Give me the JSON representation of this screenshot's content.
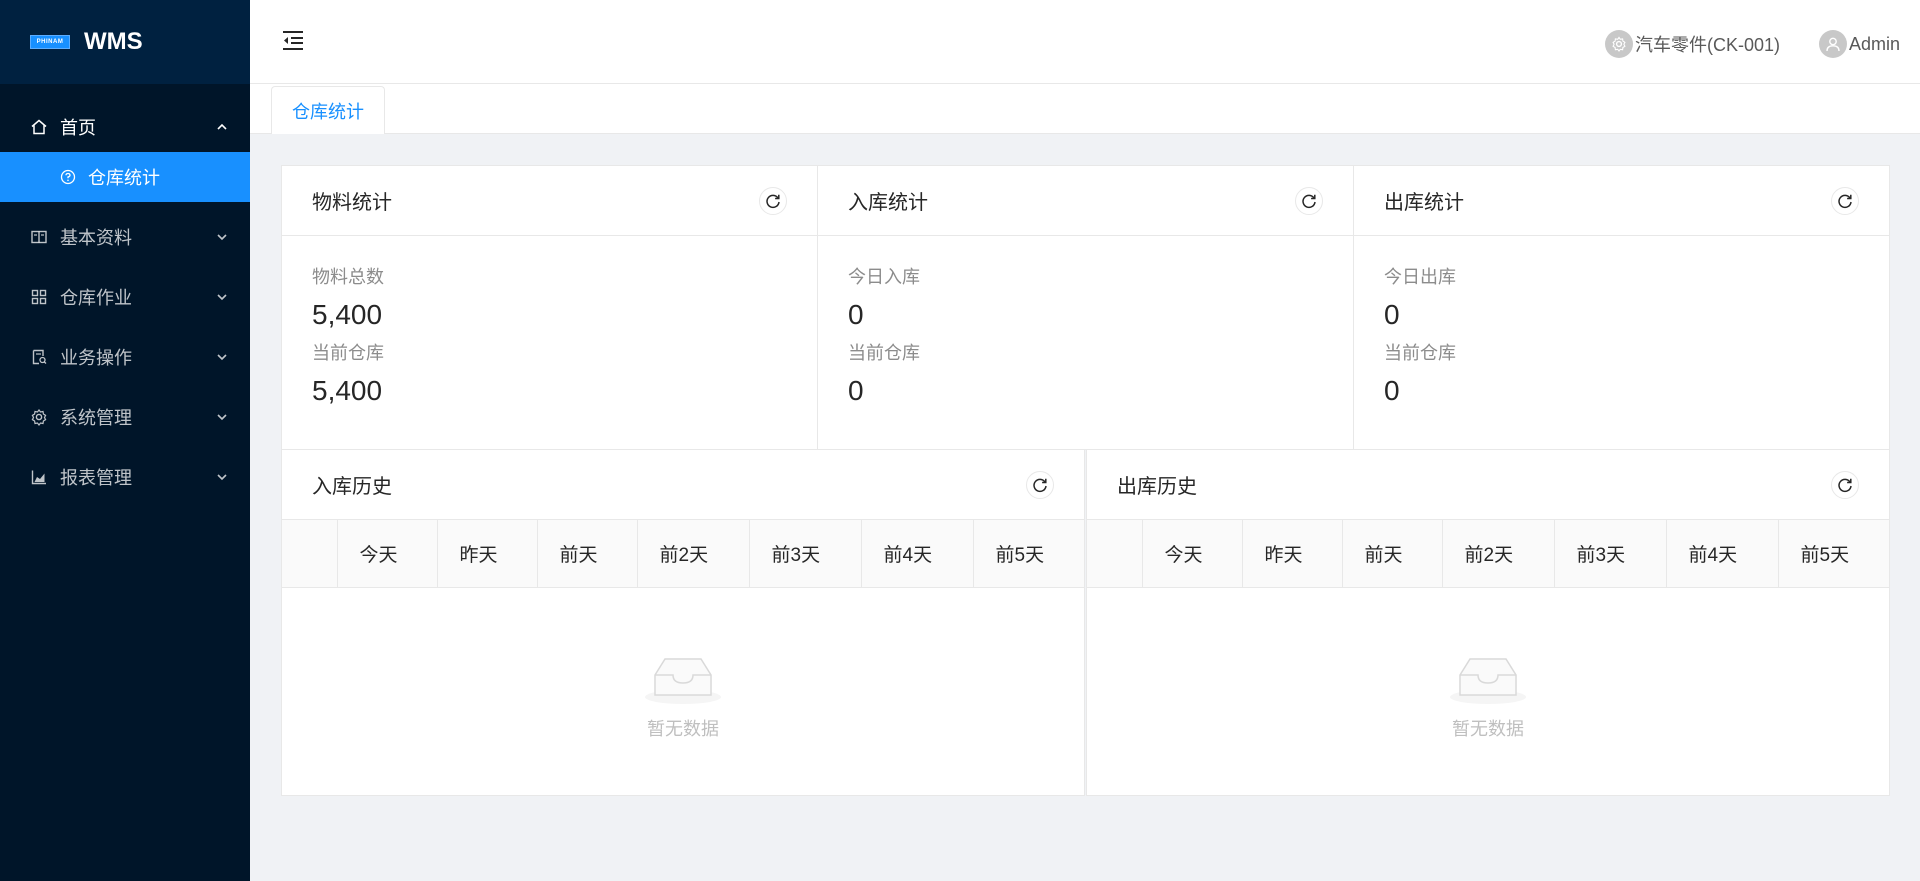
{
  "app": {
    "logo_badge": "PHINAM",
    "name": "WMS"
  },
  "sidebar": {
    "items": [
      {
        "label": "首页",
        "icon": "home-icon",
        "open": true,
        "children": [
          {
            "label": "仓库统计",
            "icon": "question-circle-icon",
            "active": true
          }
        ]
      },
      {
        "label": "基本资料",
        "icon": "book-icon"
      },
      {
        "label": "仓库作业",
        "icon": "appstore-icon"
      },
      {
        "label": "业务操作",
        "icon": "audit-icon"
      },
      {
        "label": "系统管理",
        "icon": "setting-icon"
      },
      {
        "label": "报表管理",
        "icon": "area-chart-icon"
      }
    ]
  },
  "header": {
    "warehouse": "汽车零件(CK-001)",
    "user": "Admin"
  },
  "tabs": [
    {
      "label": "仓库统计",
      "active": true
    }
  ],
  "stats": {
    "material": {
      "title": "物料统计",
      "label1": "物料总数",
      "value1": "5,400",
      "label2": "当前仓库",
      "value2": "5,400"
    },
    "inbound": {
      "title": "入库统计",
      "label1": "今日入库",
      "value1": "0",
      "label2": "当前仓库",
      "value2": "0"
    },
    "outbound": {
      "title": "出库统计",
      "label1": "今日出库",
      "value1": "0",
      "label2": "当前仓库",
      "value2": "0"
    }
  },
  "history": {
    "columns": [
      "",
      "今天",
      "昨天",
      "前天",
      "前2天",
      "前3天",
      "前4天",
      "前5天"
    ],
    "inbound": {
      "title": "入库历史",
      "empty": "暂无数据"
    },
    "outbound": {
      "title": "出库历史",
      "empty": "暂无数据"
    }
  },
  "colors": {
    "sidebar_bg": "#001529",
    "logo_bg": "#002140",
    "accent": "#1890ff",
    "page_bg": "#f0f2f5"
  }
}
